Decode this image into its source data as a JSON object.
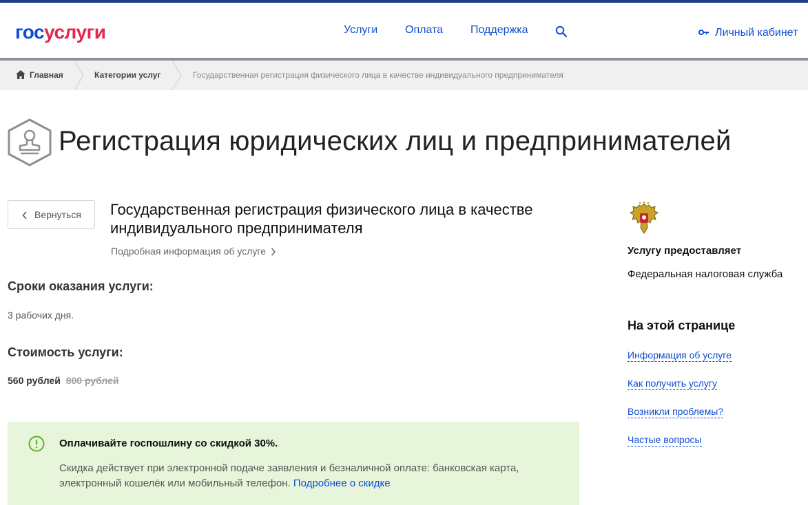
{
  "header": {
    "logo_part1": "гос",
    "logo_part2": "услуги",
    "nav": [
      "Услуги",
      "Оплата",
      "Поддержка"
    ],
    "search_icon": "search-icon",
    "cabinet_icon": "key-icon",
    "cabinet_label": "Личный кабинет"
  },
  "breadcrumbs": {
    "home": "Главная",
    "categories": "Категории услуг",
    "current": "Государственная регистрация физического лица в качестве индивидуального предпринимателя"
  },
  "page": {
    "title": "Регистрация юридических лиц и предпринимателей",
    "icon": "stamp-icon"
  },
  "service": {
    "back_label": "Вернуться",
    "title": "Государственная регистрация физического лица в качестве индивидуального предпринимателя",
    "more_info": "Подробная информация об услуге",
    "term_heading": "Сроки оказания услуги:",
    "term_value": "3 рабочих дня.",
    "cost_heading": "Стоимость услуги:",
    "cost_current": "560 рублей",
    "cost_old": "800 рублей"
  },
  "promo": {
    "title": "Оплачивайте госпошлину со скидкой 30%.",
    "text": "Скидка действует при электронной подаче заявления и безналичной оплате: банковская карта, электронный кошелёк или мобильный телефон.",
    "link": "Подробнее о скидке"
  },
  "sidebar": {
    "provider_label": "Услугу предоставляет",
    "provider_name": "Федеральная налоговая служба",
    "toc_title": "На этой странице",
    "toc": [
      "Информация об услуге",
      "Как получить услугу",
      "Возникли проблемы?",
      "Частые вопросы"
    ]
  },
  "colors": {
    "brand_blue": "#0d4cd3",
    "brand_red": "#e3274f",
    "promo_bg": "#e7f5da",
    "promo_icon": "#5fb030"
  }
}
